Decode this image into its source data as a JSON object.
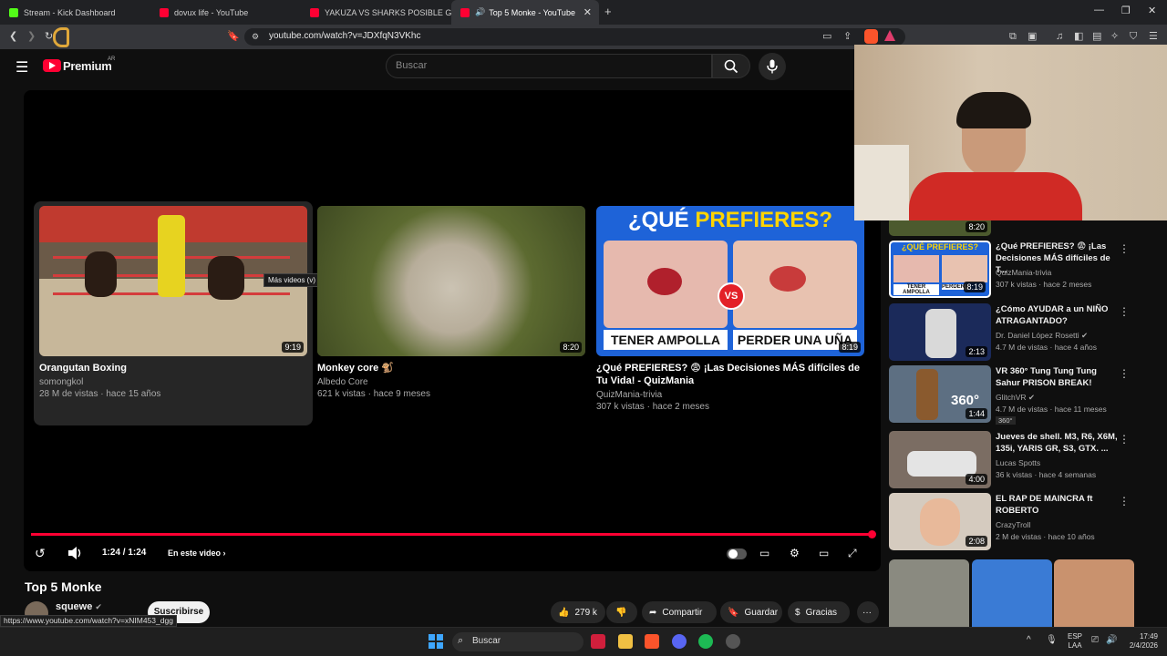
{
  "browser": {
    "tabs": [
      {
        "title": "Stream - Kick Dashboard",
        "color": "#53fc18"
      },
      {
        "title": "dovux life - YouTube",
        "color": "#ff0033"
      },
      {
        "title": "YAKUZA VS SHARKS POSIBLE GUERR",
        "color": "#ff0033"
      },
      {
        "title": "Top 5 Monke - YouTube",
        "color": "#ff0033"
      }
    ],
    "url": "youtube.com/watch?v=JDXfqN3VKhc",
    "status_link": "https://www.youtube.com/watch?v=xNIM453_dgg"
  },
  "youtube": {
    "logo": "Premium",
    "region": "AR",
    "search_placeholder": "Buscar"
  },
  "player": {
    "tooltip": "Más videos (v)",
    "time": "1:24 / 1:24",
    "chapter": "En este video",
    "progress": 1.0,
    "endscreen": [
      {
        "title": "Orangutan Boxing",
        "channel": "somongkol",
        "meta": "28 M de vistas · hace 15 años",
        "duration": "9:19"
      },
      {
        "title": "Monkey core 🐒",
        "channel": "Albedo Core",
        "meta": "621 k vistas · hace 9 meses",
        "duration": "8:20"
      },
      {
        "title": "¿Qué PREFIERES? 😨 ¡Las Decisiones MÁS difíciles de Tu Vida! - QuizMania",
        "channel": "QuizMania-trivia",
        "meta": "307 k vistas · hace 2 meses",
        "duration": "8:19",
        "thumb_heading_1": "¿QUÉ",
        "thumb_heading_2": "PREFIERES?",
        "thumb_left": "TENER AMPOLLA",
        "thumb_right": "PERDER UNA UÑA",
        "thumb_vs": "VS"
      }
    ]
  },
  "video": {
    "title": "Top 5 Monke",
    "channel": "squewe",
    "subscribe": "Suscribirse",
    "likes": "279 k",
    "share": "Compartir",
    "save": "Guardar",
    "thanks": "Gracias"
  },
  "sidebar": {
    "partial_duration": "8:20",
    "items": [
      {
        "title": "¿Qué PREFIERES? 😨 ¡Las Decisiones MÁS difíciles de T...",
        "channel": "QuizMania-trivia",
        "meta": "307 k vistas · hace 2 meses",
        "duration": "8:19",
        "thumb_heading": "¿QUÉ PREFIERES?",
        "thumb_left": "TENER AMPOLLA",
        "thumb_right": "PERDER UN"
      },
      {
        "title": "¿Cómo AYUDAR a un NIÑO ATRAGANTADO?",
        "channel": "Dr. Daniel López Rosetti",
        "meta": "4.7 M de vistas · hace 4 años",
        "duration": "2:13"
      },
      {
        "title": "VR 360° Tung Tung Tung Sahur PRISON BREAK!",
        "channel": "GlitchVR",
        "meta": "4.7 M de vistas · hace 11 meses",
        "duration": "1:44",
        "badge": "360°",
        "thumb_text": "360°"
      },
      {
        "title": "Jueves de shell. M3, R6, X6M, 135i, YARIS GR, S3, GTX. ...",
        "channel": "Lucas Spotts",
        "meta": "36 k vistas · hace 4 semanas",
        "duration": "4:00"
      },
      {
        "title": "EL RAP DE MAINCRA ft ROBERTO",
        "channel": "CrazyTroll",
        "meta": "2 M de vistas · hace 10 años",
        "duration": "2:08"
      }
    ]
  },
  "taskbar": {
    "search": "Buscar",
    "lang": "ESP",
    "lang2": "LAA",
    "time": "17:49",
    "date": "2/4/2026"
  }
}
